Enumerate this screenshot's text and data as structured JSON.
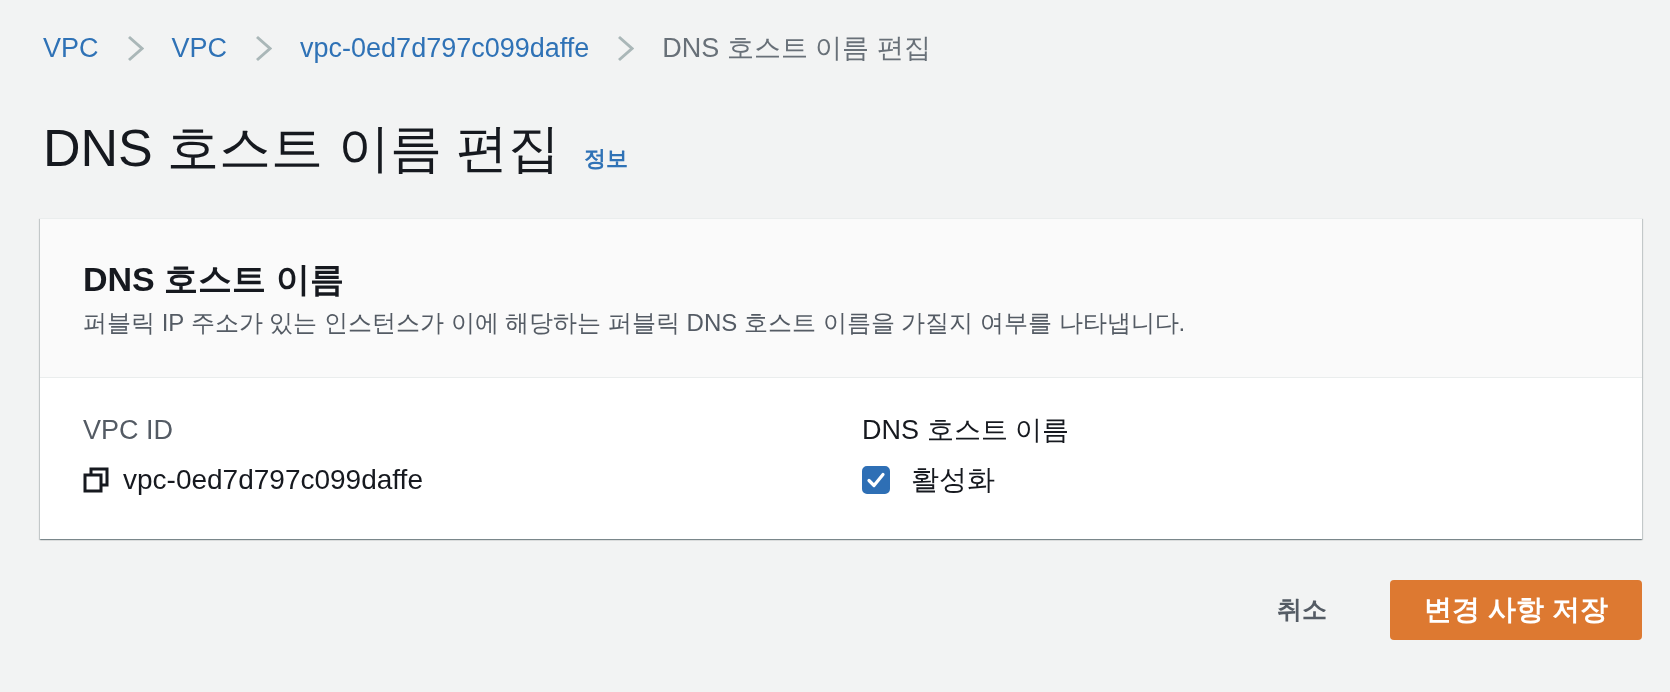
{
  "breadcrumbs": [
    {
      "label": "VPC",
      "kind": "link"
    },
    {
      "label": "VPC",
      "kind": "link"
    },
    {
      "label": "vpc-0ed7d797c099daffe",
      "kind": "link"
    },
    {
      "label": "DNS 호스트 이름 편집",
      "kind": "current"
    }
  ],
  "page": {
    "title": "DNS 호스트 이름 편집",
    "info_link": "정보"
  },
  "panel": {
    "title": "DNS 호스트 이름",
    "description": "퍼블릭 IP 주소가 있는 인스턴스가 이에 해당하는 퍼블릭 DNS 호스트 이름을 가질지 여부를 나타냅니다.",
    "fields": [
      {
        "kind": "copyable",
        "label": "VPC ID",
        "value": "vpc-0ed7d797c099daffe"
      },
      {
        "kind": "checkbox",
        "label": "DNS 호스트 이름",
        "option": "활성화",
        "checked": true
      }
    ]
  },
  "actions": [
    {
      "label": "취소",
      "kind": "link"
    },
    {
      "label": "변경 사항 저장",
      "kind": "primary"
    }
  ]
}
